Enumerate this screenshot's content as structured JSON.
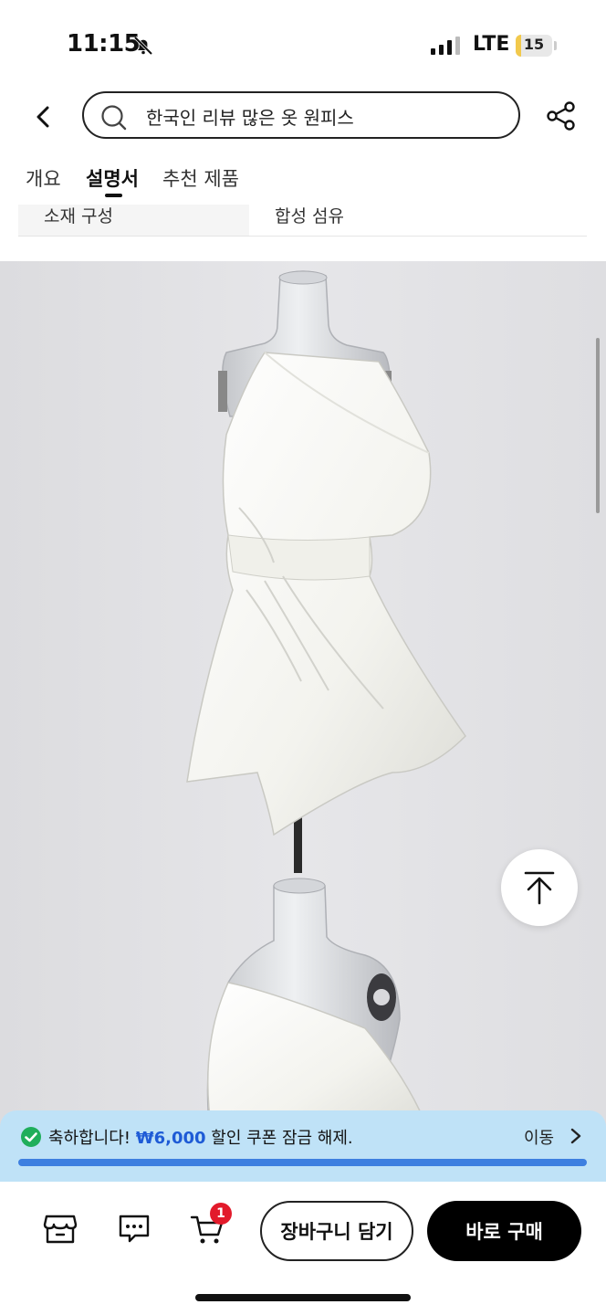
{
  "status_bar": {
    "time": "11:15",
    "network": "LTE",
    "battery": "15",
    "battery_level": 0.15
  },
  "search": {
    "query": "한국인 리뷰 많은 옷 원피스"
  },
  "tabs": [
    {
      "label": "개요"
    },
    {
      "label": "설명서",
      "active": true
    },
    {
      "label": "추천 제품"
    }
  ],
  "specs": {
    "key": "소재 구성",
    "value": "합성 섬유"
  },
  "images": [
    {
      "icon": "white-asymmetric-dress-on-mannequin"
    },
    {
      "icon": "white-dress-mannequin-detail"
    }
  ],
  "coupon": {
    "prefix": "축하합니다!",
    "amount": "₩6,000",
    "suffix": "할인 쿠폰 잠금 해제.",
    "action": "이동"
  },
  "bottom_bar": {
    "cart_count": "1",
    "add_to_cart": "장바구니 담기",
    "buy_now": "바로 구매"
  },
  "colors": {
    "accent_blue": "#1e5bd6",
    "banner_bg": "#bfe2f7",
    "badge_red": "#e21a2b",
    "check_green": "#1fae5b"
  }
}
